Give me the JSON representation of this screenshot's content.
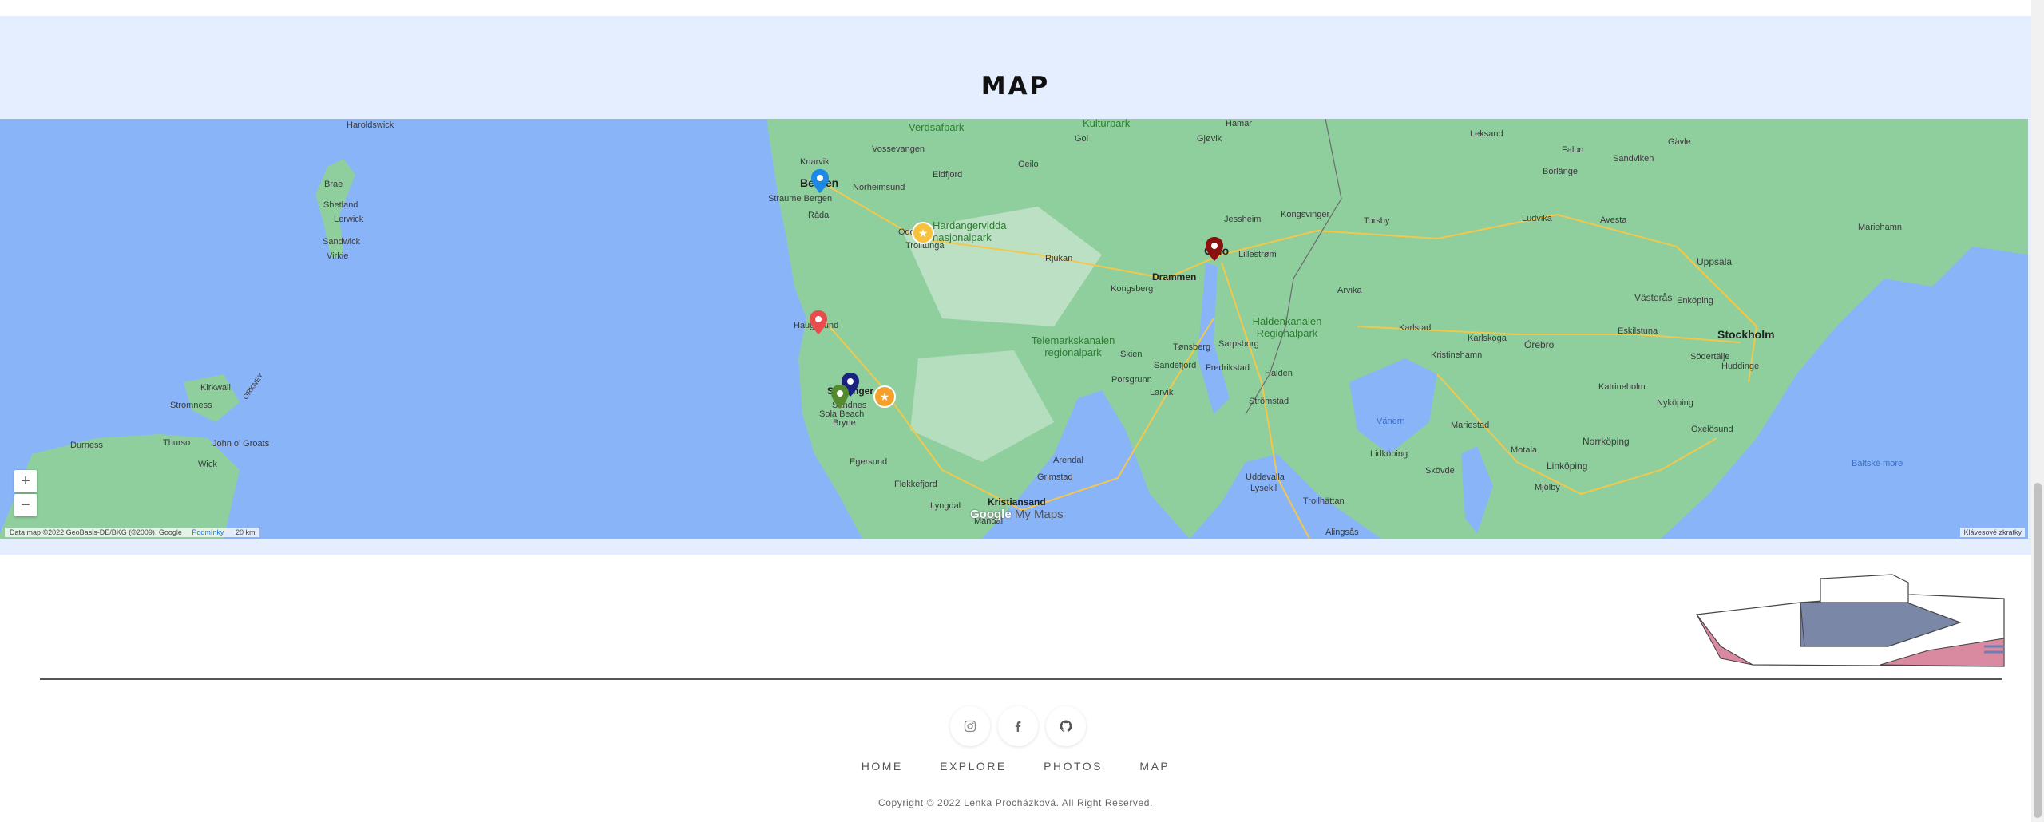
{
  "section": {
    "title": "MAP"
  },
  "map": {
    "places_west": [
      "Haroldswick",
      "Brae",
      "Shetland",
      "Lerwick",
      "Sandwick",
      "Virkie",
      "Kirkwall",
      "Stromness",
      "Durness",
      "Thurso",
      "John o' Groats",
      "Wick",
      "ORKNEY"
    ],
    "places_norway": [
      "Knarvik",
      "Vossevangen",
      "Bergen",
      "Norheimsund",
      "Eidfjord",
      "Geilo",
      "Straume Bergen",
      "Rådal",
      "Odda",
      "Trolltunga",
      "Hardangervidda nasjonalpark",
      "Rjukan",
      "Gjøvik",
      "Hamar",
      "Gol",
      "Jessheim",
      "Oslo",
      "Lillestrøm",
      "Drammen",
      "Kongsberg",
      "Haugesund",
      "Telemarkskanalen regionalpark",
      "Skien",
      "Tønsberg",
      "Sandefjord",
      "Porsgrunn",
      "Larvik",
      "Stavanger",
      "Sandnes",
      "Sola Beach",
      "Bryne",
      "Egersund",
      "Flekkefjord",
      "Lyngdal",
      "Mandal",
      "Kristiansand",
      "Grimstad",
      "Arendal",
      "Verdsafpark",
      "Kulturpark"
    ],
    "places_sweden": [
      "Kongsvinger",
      "Torsby",
      "Leksand",
      "Falun",
      "Sandviken",
      "Gävle",
      "Borlänge",
      "Ludvika",
      "Avesta",
      "Mariehamn",
      "Uppsala",
      "Arvika",
      "Västerås",
      "Enköping",
      "Karlstad",
      "Karlskoga",
      "Örebro",
      "Eskilstuna",
      "Stockholm",
      "Södertälje",
      "Huddinge",
      "Kristinehamn",
      "Katrineholm",
      "Haldenkanalen Regionalpark",
      "Sarpsborg",
      "Fredrikstad",
      "Halden",
      "Strömstad",
      "Vänern",
      "Mariestad",
      "Nyköping",
      "Oxelösund",
      "Lidköping",
      "Skövde",
      "Uddevalla",
      "Trollhättan",
      "Lysekil",
      "Motala",
      "Linköping",
      "Norrköping",
      "Mjölby",
      "Alingsås"
    ],
    "sea_label": "Baltské more",
    "zoom_in": "+",
    "zoom_out": "−",
    "attribution": "Data map ©2022 GeoBasis-DE/BKG (©2009), Google",
    "terms": "Podmínky",
    "scale": "20 km",
    "shortcuts": "Klávesové zkratky",
    "branding": "My Maps",
    "colors": {
      "water": "#8ab4f8",
      "land": "#8fcf9e",
      "section_bg": "#e4eefe"
    }
  },
  "footer": {
    "social": [
      "instagram-icon",
      "facebook-icon",
      "github-icon"
    ],
    "nav": [
      "HOME",
      "EXPLORE",
      "PHOTOS",
      "MAP"
    ],
    "copyright": "Copyright © 2022 Lenka Procházková. All Right Reserved."
  }
}
